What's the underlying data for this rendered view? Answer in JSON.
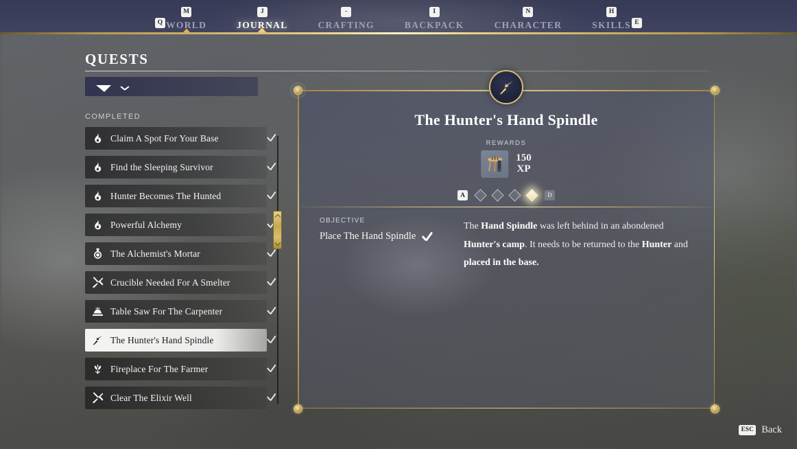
{
  "nav": {
    "left_key": "Q",
    "right_key": "E",
    "tabs": [
      {
        "key": "M",
        "label": "WORLD",
        "active": false
      },
      {
        "key": "J",
        "label": "JOURNAL",
        "active": true
      },
      {
        "key": "-",
        "label": "CRAFTING",
        "active": false
      },
      {
        "key": "I",
        "label": "BACKPACK",
        "active": false
      },
      {
        "key": "N",
        "label": "CHARACTER",
        "active": false
      },
      {
        "key": "H",
        "label": "SKILLS",
        "active": false
      }
    ]
  },
  "page": {
    "title": "QUESTS"
  },
  "list": {
    "section_label": "COMPLETED",
    "quests": [
      {
        "name": "Claim A Spot For Your Base",
        "icon": "flame-icon",
        "completed": true,
        "selected": false
      },
      {
        "name": "Find the Sleeping Survivor",
        "icon": "flame-icon",
        "completed": true,
        "selected": false
      },
      {
        "name": "Hunter Becomes The Hunted",
        "icon": "flame-icon",
        "completed": true,
        "selected": false
      },
      {
        "name": "Powerful Alchemy",
        "icon": "flame-icon",
        "completed": true,
        "selected": false
      },
      {
        "name": "The Alchemist's Mortar",
        "icon": "mortar-icon",
        "completed": true,
        "selected": false
      },
      {
        "name": "Crucible Needed For A Smelter",
        "icon": "crucible-icon",
        "completed": true,
        "selected": false
      },
      {
        "name": "Table Saw For The Carpenter",
        "icon": "tablesaw-icon",
        "completed": true,
        "selected": false
      },
      {
        "name": "The Hunter's Hand Spindle",
        "icon": "spindle-icon",
        "completed": true,
        "selected": true
      },
      {
        "name": "Fireplace For The Farmer",
        "icon": "plant-icon",
        "completed": true,
        "selected": false
      },
      {
        "name": "Clear The Elixir Well",
        "icon": "crucible-icon",
        "completed": true,
        "selected": false
      }
    ]
  },
  "detail": {
    "medallion_icon": "spindle-icon",
    "title": "The Hunter's Hand Spindle",
    "rewards_label": "REWARDS",
    "reward": {
      "item_icon": "spinning-wheel-icon",
      "amount": "150",
      "unit": "XP"
    },
    "pager": {
      "prev_key": "A",
      "next_key": "D",
      "pages": 4,
      "active_index": 3
    },
    "objective_label": "OBJECTIVE",
    "objective_text": "Place The Hand Spindle",
    "objective_done": true,
    "description": [
      {
        "text": "The ",
        "bold": false
      },
      {
        "text": "Hand Spindle",
        "bold": true
      },
      {
        "text": " was left behind in an abondened ",
        "bold": false
      },
      {
        "text": "Hunter's camp",
        "bold": true
      },
      {
        "text": ". It needs to be returned to the ",
        "bold": false
      },
      {
        "text": "Hunter",
        "bold": true
      },
      {
        "text": " and ",
        "bold": false
      },
      {
        "text": "placed in the base.",
        "bold": true
      }
    ]
  },
  "footer": {
    "back_key": "ESC",
    "back_label": "Back"
  },
  "colors": {
    "gold": "#e2c87f",
    "panel_border": "#d9bd70",
    "accent_glow": "#fff3c4",
    "nav_inactive": "#9ea2b8"
  }
}
